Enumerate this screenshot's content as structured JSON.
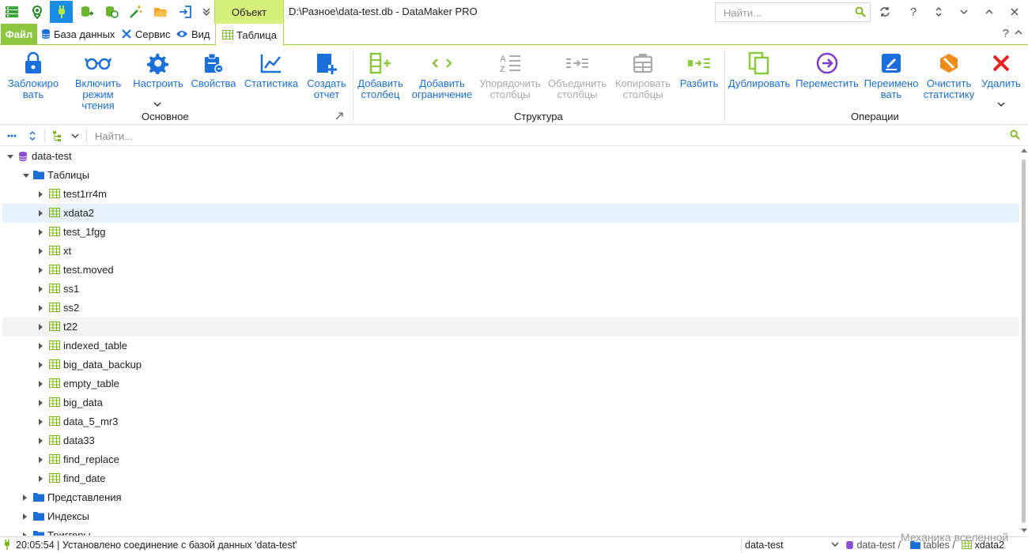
{
  "app": {
    "context_tab": "Объект",
    "title": "D:\\Разное\\data-test.db - DataMaker PRO",
    "search_placeholder": "Найти..."
  },
  "quick_access": [
    {
      "icon": "app-menu-icon"
    },
    {
      "icon": "map-pin-icon"
    },
    {
      "icon": "plug-icon"
    },
    {
      "icon": "database-add-icon"
    },
    {
      "icon": "database-refresh-icon"
    },
    {
      "icon": "magic-wand-icon"
    },
    {
      "icon": "folder-open-icon"
    },
    {
      "icon": "sign-in-icon"
    },
    {
      "icon": "more-chevron-icon"
    }
  ],
  "ribbon_tabs": {
    "file": "Файл",
    "database": "База данных",
    "service": "Сервис",
    "view": "Вид",
    "table": "Таблица"
  },
  "ribbon": {
    "groups": {
      "main": "Основное",
      "structure": "Структура",
      "operations": "Операции"
    },
    "buttons": [
      {
        "id": "lock",
        "label": "Заблокиро\nвать",
        "icon": "lock-icon",
        "enabled": true
      },
      {
        "id": "readonly",
        "label": "Включить\nрежим\nчтения",
        "icon": "glasses-icon",
        "enabled": true
      },
      {
        "id": "configure",
        "label": "Настроить",
        "icon": "gear-icon",
        "enabled": true
      },
      {
        "id": "properties",
        "label": "Свойства",
        "icon": "properties-icon",
        "enabled": true
      },
      {
        "id": "statistics",
        "label": "Статистика",
        "icon": "chart-line-icon",
        "enabled": true
      },
      {
        "id": "create-report",
        "label": "Создать\nотчет",
        "icon": "report-add-icon",
        "enabled": true
      },
      {
        "id": "add-column",
        "label": "Добавить\nстолбец",
        "icon": "add-column-icon",
        "enabled": true
      },
      {
        "id": "add-constraint",
        "label": "Добавить\nограничение",
        "icon": "code-brackets-icon",
        "enabled": true
      },
      {
        "id": "sort-columns",
        "label": "Упорядочить\nстолбцы",
        "icon": "sort-az-icon",
        "enabled": false
      },
      {
        "id": "merge-columns",
        "label": "Объединить\nстолбцы",
        "icon": "merge-icon",
        "enabled": false
      },
      {
        "id": "copy-columns",
        "label": "Копировать\nстолбцы",
        "icon": "copy-table-icon",
        "enabled": false
      },
      {
        "id": "split",
        "label": "Разбить",
        "icon": "split-icon",
        "enabled": true
      },
      {
        "id": "duplicate",
        "label": "Дублировать",
        "icon": "duplicate-icon",
        "enabled": true
      },
      {
        "id": "move",
        "label": "Переместить",
        "icon": "move-circle-icon",
        "enabled": true
      },
      {
        "id": "rename",
        "label": "Переимено\nвать",
        "icon": "rename-icon",
        "enabled": true
      },
      {
        "id": "clear-stats",
        "label": "Очистить\nстатистику",
        "icon": "clear-stats-icon",
        "enabled": true
      },
      {
        "id": "delete",
        "label": "Удалить",
        "icon": "delete-x-icon",
        "enabled": true
      }
    ]
  },
  "tree_toolbar": {
    "search_placeholder": "Найти..."
  },
  "tree": {
    "root": "data-test",
    "tables_folder": "Таблицы",
    "tables": [
      "test1rr4m",
      "xdata2",
      "test_1fgg",
      "xt",
      "test.moved",
      "ss1",
      "ss2",
      "t22",
      "indexed_table",
      "big_data_backup",
      "empty_table",
      "big_data",
      "data_5_mr3",
      "data33",
      "find_replace",
      "find_date"
    ],
    "selected": "xdata2",
    "hovered": "t22",
    "folders": [
      "Представления",
      "Индексы",
      "Триггеры"
    ]
  },
  "status": {
    "message": "20:05:54 | Установлено соединение с базой данных 'data-test'",
    "database_select": "data-test",
    "breadcrumb": [
      "data-test",
      "tables",
      "xdata2"
    ]
  },
  "watermark": "Механика вселенной",
  "colors": {
    "accent_green": "#8dc63f",
    "context_tab": "#d6f07c",
    "ribbon_blue": "#1a6fd8",
    "selection": "#e7f1fb"
  }
}
